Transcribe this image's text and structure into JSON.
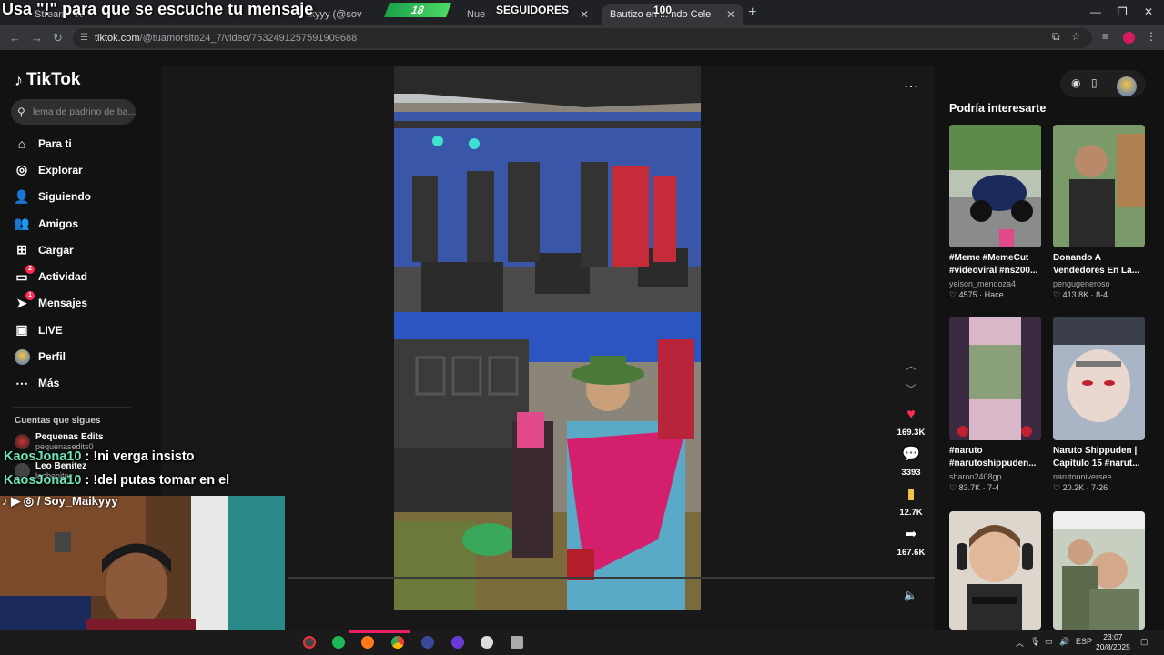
{
  "overlay": {
    "title": "Usa \"!\" para que se escuche tu mensaje",
    "followers_label": "SEGUIDORES",
    "goal_current": "18",
    "goal_target": "100",
    "social_handle": "/ Soy_Maikyyy"
  },
  "browser": {
    "tabs": [
      {
        "label": "Stream - K"
      },
      {
        "label": "ikyyy (@sov"
      },
      {
        "label": "Nue"
      },
      {
        "label": "Bautizo en ... ndo Cele"
      }
    ],
    "url_host": "tiktok.com",
    "url_path": "/@tuamorsito24_7/video/7532491257591909688"
  },
  "tiktok": {
    "logo": "TikTok",
    "search_placeholder": "lema de padrino de ba...",
    "nav": [
      {
        "label": "Para ti",
        "icon": "home-icon",
        "badge": ""
      },
      {
        "label": "Explorar",
        "icon": "compass-icon",
        "badge": ""
      },
      {
        "label": "Siguiendo",
        "icon": "following-icon",
        "badge": ""
      },
      {
        "label": "Amigos",
        "icon": "friends-icon",
        "badge": ""
      },
      {
        "label": "Cargar",
        "icon": "upload-icon",
        "badge": ""
      },
      {
        "label": "Actividad",
        "icon": "activity-icon",
        "badge": "2"
      },
      {
        "label": "Mensajes",
        "icon": "messages-icon",
        "badge": "1"
      },
      {
        "label": "LIVE",
        "icon": "live-icon",
        "badge": ""
      },
      {
        "label": "Perfil",
        "icon": "profile-avatar",
        "badge": ""
      },
      {
        "label": "Más",
        "icon": "more-icon",
        "badge": ""
      }
    ],
    "following_header": "Cuentas que sigues",
    "following": [
      {
        "name": "Pequenas Edits",
        "handle": "pequenasedits0"
      },
      {
        "name": "Leo Benitez",
        "handle": "leobenitez"
      }
    ],
    "actions": {
      "likes": "169.3K",
      "comments": "3393",
      "saves": "12.7K",
      "shares": "167.6K"
    },
    "recommended_title": "Podría interesarte",
    "recommended": [
      {
        "title": "#Meme #MemeCut #videoviral #ns200...",
        "user": "yeison_mendoza4",
        "likes": "4575",
        "time": "Hace..."
      },
      {
        "title": "Donando A Vendedores En La...",
        "user": "pengugeneroso",
        "likes": "413.8K",
        "time": "8-4"
      },
      {
        "title": "#naruto #narutoshippuden...",
        "user": "sharon2408gp",
        "likes": "83.7K",
        "time": "7-4"
      },
      {
        "title": "Naruto Shippuden | Capítulo 15 #narut...",
        "user": "narutouniversee",
        "likes": "20.2K",
        "time": "7-26"
      }
    ]
  },
  "chat": [
    {
      "user": "KaosJona10",
      "message": " : !ni verga insisto"
    },
    {
      "user": "KaosJona10",
      "message": " : !del putas tomar en el"
    }
  ],
  "taskbar": {
    "lang": "ESP",
    "time": "23:07",
    "date": "20/8/2025"
  }
}
